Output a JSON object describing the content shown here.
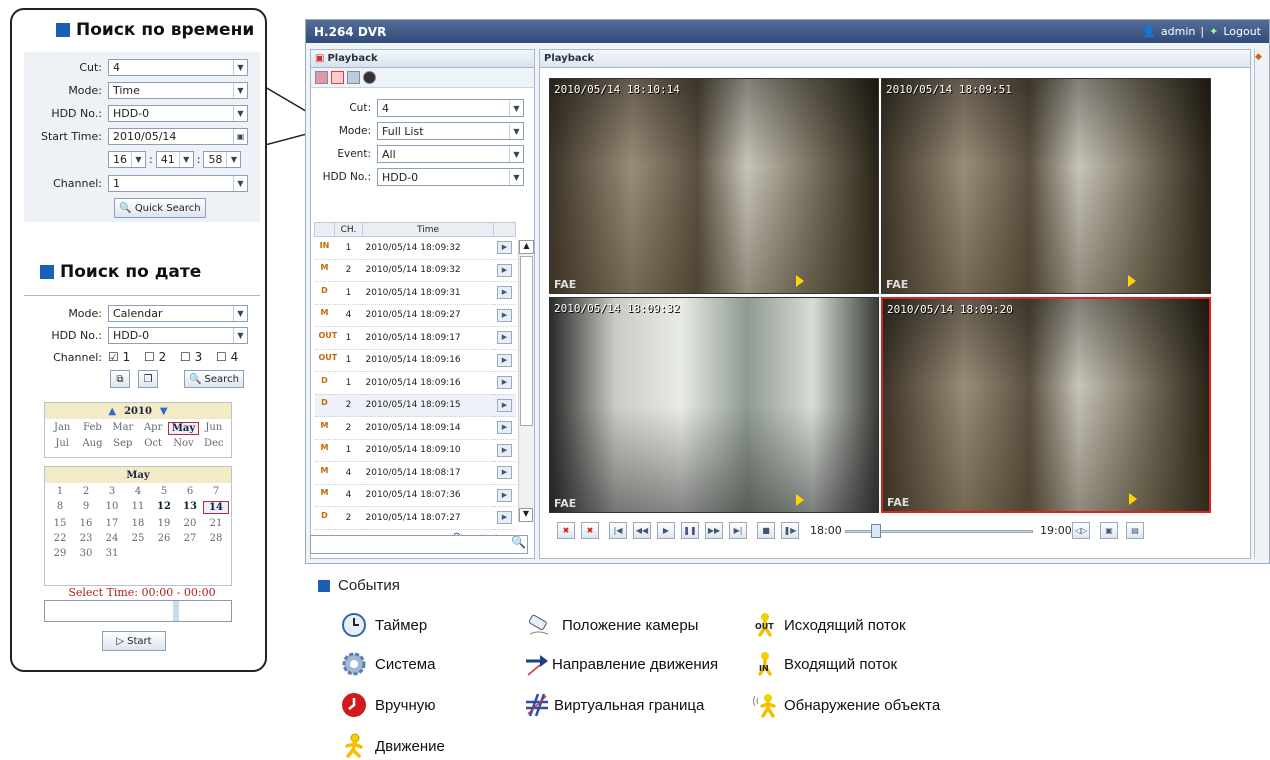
{
  "callout": {
    "time_search": {
      "title": "Поиск по времени",
      "fields": [
        {
          "label": "Cut:",
          "value": "4"
        },
        {
          "label": "Mode:",
          "value": "Time"
        },
        {
          "label": "HDD No.:",
          "value": "HDD-0"
        },
        {
          "label": "Start Time:",
          "value": "2010/05/14"
        },
        {
          "label": "Channel:",
          "value": "1"
        }
      ],
      "time": {
        "hour": "16",
        "minute": "41",
        "second": "58",
        "sep": ":"
      },
      "quick_search_label": "Quick Search"
    },
    "date_search": {
      "title": "Поиск по дате",
      "fields": [
        {
          "label": "Mode:",
          "value": "Calendar"
        },
        {
          "label": "HDD No.:",
          "value": "HDD-0"
        }
      ],
      "channel_label": "Channel:",
      "channels": [
        "1",
        "2",
        "3",
        "4"
      ],
      "search_label": "Search",
      "year": "2010",
      "months": [
        "Jan",
        "Feb",
        "Mar",
        "Apr",
        "May",
        "Jun",
        "Jul",
        "Aug",
        "Sep",
        "Oct",
        "Nov",
        "Dec"
      ],
      "month_title": "May",
      "days": [
        "1",
        "2",
        "3",
        "4",
        "5",
        "6",
        "7",
        "8",
        "9",
        "10",
        "11",
        "12",
        "13",
        "14",
        "15",
        "16",
        "17",
        "18",
        "19",
        "20",
        "21",
        "22",
        "23",
        "24",
        "25",
        "26",
        "27",
        "28",
        "29",
        "30",
        "31"
      ],
      "select_time": "Select Time: 00:00 - 00:00",
      "start_label": "Start"
    }
  },
  "dvr": {
    "title": "H.264 DVR",
    "user": "admin",
    "sep": "|",
    "logout": "Logout",
    "left_panel": {
      "header": "Playback",
      "fields": [
        {
          "label": "Cut:",
          "value": "4"
        },
        {
          "label": "Mode:",
          "value": "Full List"
        },
        {
          "label": "Event:",
          "value": "All"
        },
        {
          "label": "HDD No.:",
          "value": "HDD-0"
        }
      ],
      "col_ch": "CH.",
      "col_time": "Time",
      "rows": [
        {
          "icon": "IN",
          "ch": "1",
          "time": "2010/05/14 18:09:32"
        },
        {
          "icon": "M",
          "ch": "2",
          "time": "2010/05/14 18:09:32"
        },
        {
          "icon": "D",
          "ch": "1",
          "time": "2010/05/14 18:09:31"
        },
        {
          "icon": "M",
          "ch": "4",
          "time": "2010/05/14 18:09:27"
        },
        {
          "icon": "OUT",
          "ch": "1",
          "time": "2010/05/14 18:09:17"
        },
        {
          "icon": "OUT",
          "ch": "1",
          "time": "2010/05/14 18:09:16"
        },
        {
          "icon": "D",
          "ch": "1",
          "time": "2010/05/14 18:09:16"
        },
        {
          "icon": "D",
          "ch": "2",
          "time": "2010/05/14 18:09:15"
        },
        {
          "icon": "M",
          "ch": "2",
          "time": "2010/05/14 18:09:14"
        },
        {
          "icon": "M",
          "ch": "1",
          "time": "2010/05/14 18:09:10"
        },
        {
          "icon": "M",
          "ch": "4",
          "time": "2010/05/14 18:08:17"
        },
        {
          "icon": "M",
          "ch": "4",
          "time": "2010/05/14 18:07:36"
        },
        {
          "icon": "D",
          "ch": "2",
          "time": "2010/05/14 18:07:27"
        }
      ]
    },
    "right_panel": {
      "header": "Playback",
      "cams": [
        {
          "ts": "2010/05/14 18:10:14",
          "tag": "FAE"
        },
        {
          "ts": "2010/05/14 18:09:51",
          "tag": "FAE"
        },
        {
          "ts": "2010/05/14 18:09:32",
          "tag": "FAE"
        },
        {
          "ts": "2010/05/14 18:09:20",
          "tag": "FAE"
        }
      ],
      "time_start": "18:00",
      "time_end": "19:00"
    }
  },
  "legend": {
    "title": "События",
    "items": [
      {
        "name": "timer",
        "label": "Таймер"
      },
      {
        "name": "system",
        "label": "Система"
      },
      {
        "name": "manual",
        "label": "Вручную"
      },
      {
        "name": "motion",
        "label": "Движение"
      },
      {
        "name": "camera-position",
        "label": "Положение камеры"
      },
      {
        "name": "direction",
        "label": "Направление движения"
      },
      {
        "name": "virtual-border",
        "label": "Виртуальная граница"
      },
      {
        "name": "outgoing",
        "label": "Исходящий поток"
      },
      {
        "name": "incoming",
        "label": "Входящий поток"
      },
      {
        "name": "object-detection",
        "label": "Обнаружение объекта"
      }
    ]
  }
}
